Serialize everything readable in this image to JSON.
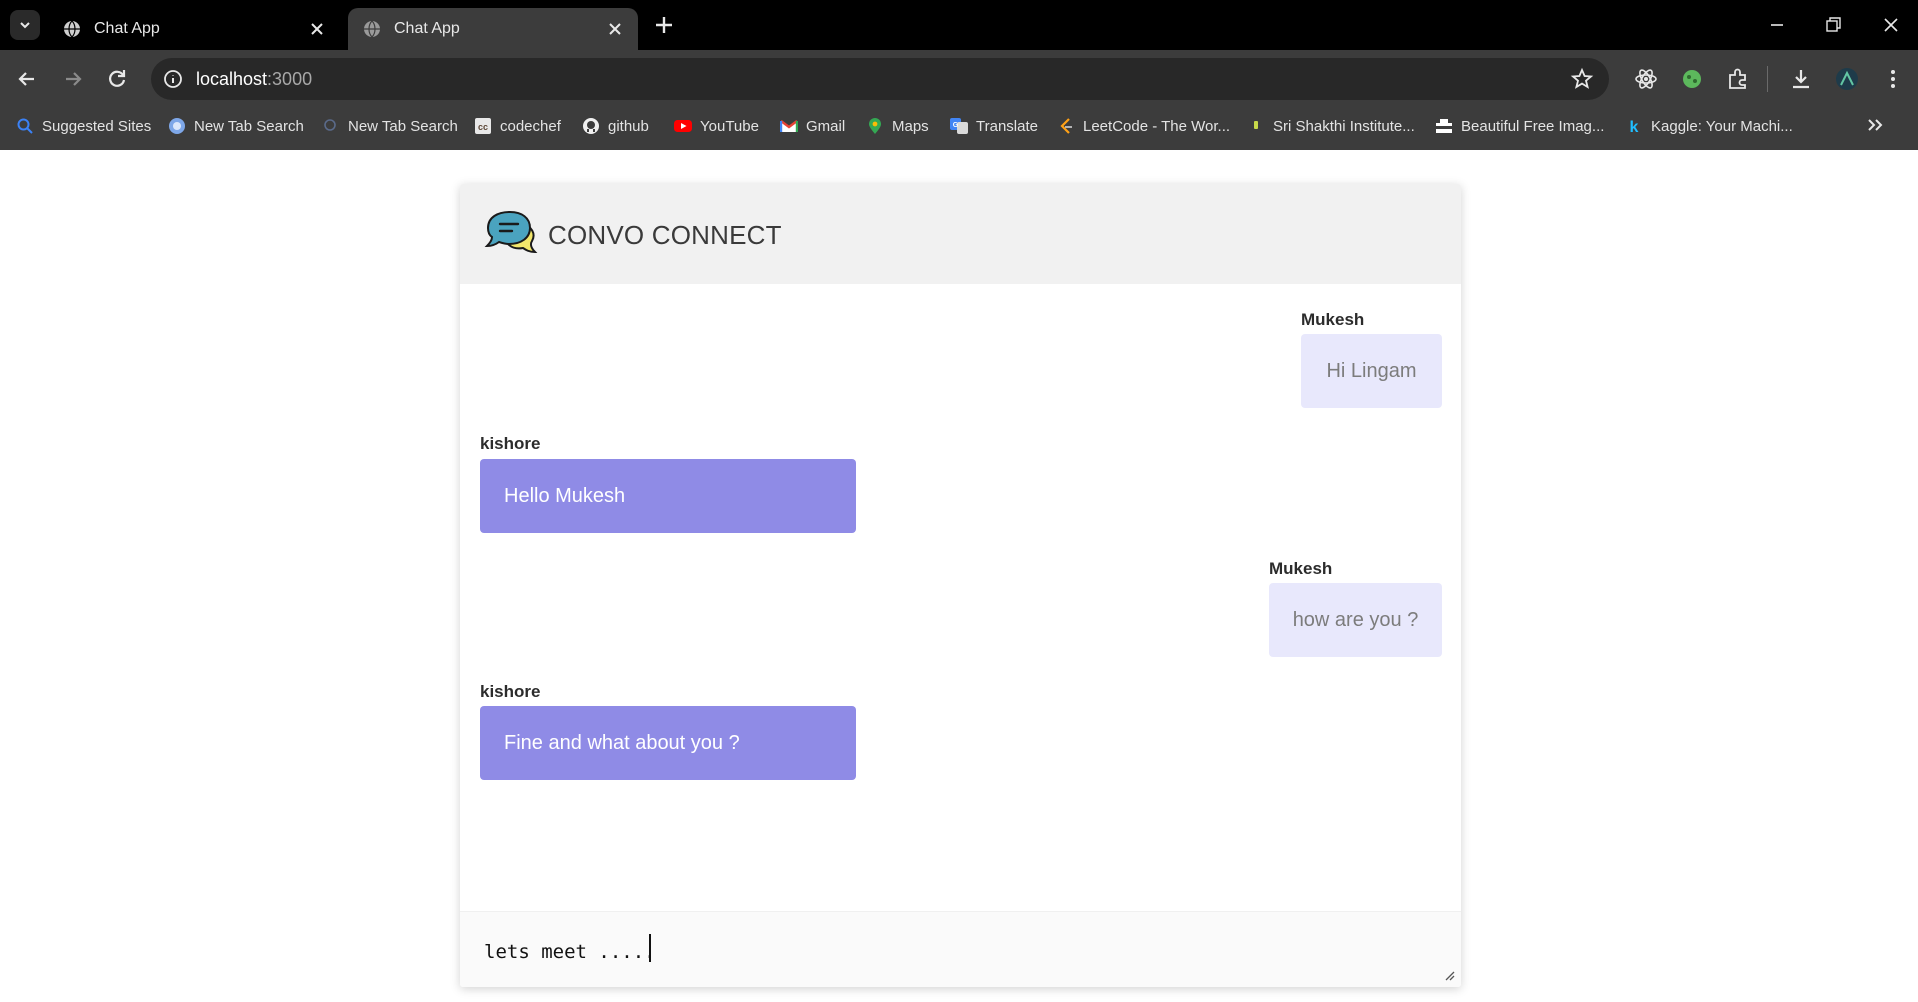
{
  "browser": {
    "tabs": [
      {
        "title": "Chat App",
        "active": false
      },
      {
        "title": "Chat App",
        "active": true
      }
    ],
    "url": {
      "host": "localhost",
      "port": ":3000"
    },
    "bookmarks": [
      {
        "label": "Suggested Sites",
        "icon": "search-icon"
      },
      {
        "label": "New Tab Search",
        "icon": "globe-icon"
      },
      {
        "label": "New Tab Search",
        "icon": "search-icon"
      },
      {
        "label": "codechef",
        "icon": "codechef-icon"
      },
      {
        "label": "github",
        "icon": "github-icon"
      },
      {
        "label": "YouTube",
        "icon": "youtube-icon"
      },
      {
        "label": "Gmail",
        "icon": "gmail-icon"
      },
      {
        "label": "Maps",
        "icon": "maps-pin-icon"
      },
      {
        "label": "Translate",
        "icon": "translate-icon"
      },
      {
        "label": "LeetCode - The Wor...",
        "icon": "leetcode-icon"
      },
      {
        "label": "Sri Shakthi Institute...",
        "icon": "bookmark-icon"
      },
      {
        "label": "Beautiful Free Imag...",
        "icon": "camera-icon"
      },
      {
        "label": "Kaggle: Your Machi...",
        "icon": "kaggle-icon"
      }
    ],
    "colors": {
      "tabbar": "#000000",
      "toolbar": "#3c3c3c"
    }
  },
  "app": {
    "title": "CONVO CONNECT",
    "messages": [
      {
        "sender": "Mukesh",
        "text": "Hi Lingam",
        "direction": "outgoing"
      },
      {
        "sender": "kishore",
        "text": "Hello Mukesh",
        "direction": "incoming"
      },
      {
        "sender": "Mukesh",
        "text": "how are you ?",
        "direction": "outgoing"
      },
      {
        "sender": "kishore",
        "text": "Fine and what about you ?",
        "direction": "incoming"
      }
    ],
    "composer": {
      "value": "lets meet ....."
    },
    "colors": {
      "incoming_bubble": "#8f8be6",
      "outgoing_bubble": "#e8e8fc",
      "header": "#f1f1f1"
    }
  }
}
